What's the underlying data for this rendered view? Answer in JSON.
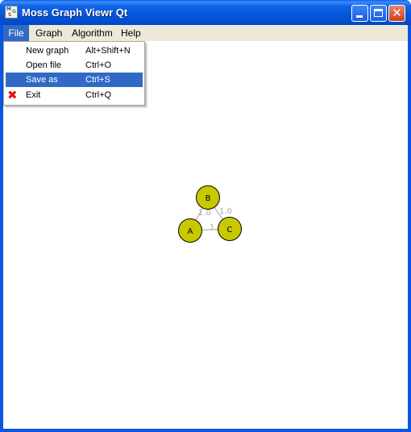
{
  "window": {
    "title": "Moss Graph Viewr Qt",
    "icon_letters": [
      "M",
      "G",
      "S"
    ]
  },
  "menubar": {
    "items": [
      {
        "label": "File",
        "active": true
      },
      {
        "label": "Graph"
      },
      {
        "label": "Algorithm"
      },
      {
        "label": "Help"
      }
    ]
  },
  "file_menu": {
    "items": [
      {
        "label": "New graph",
        "shortcut": "Alt+Shift+N"
      },
      {
        "label": "Open file",
        "shortcut": "Ctrl+O"
      },
      {
        "label": "Save as",
        "shortcut": "Ctrl+S",
        "highlighted": true
      },
      {
        "label": "Exit",
        "shortcut": "Ctrl+Q",
        "icon": "red-x-icon"
      }
    ]
  },
  "graph": {
    "node_color": "#c8c800",
    "nodes": [
      {
        "label": "A"
      },
      {
        "label": "B"
      },
      {
        "label": "C"
      }
    ],
    "edges": [
      {
        "from": "A",
        "to": "B",
        "weight": "1.0"
      },
      {
        "from": "B",
        "to": "C",
        "weight": "1.0"
      },
      {
        "from": "A",
        "to": "C",
        "weight": "1."
      }
    ]
  },
  "colors": {
    "title_bar": "#0a55e3",
    "menu_highlight": "#316ac5",
    "menubar_bg": "#ece9d8",
    "close_button": "#d9542c",
    "exit_icon": "#e01818"
  }
}
